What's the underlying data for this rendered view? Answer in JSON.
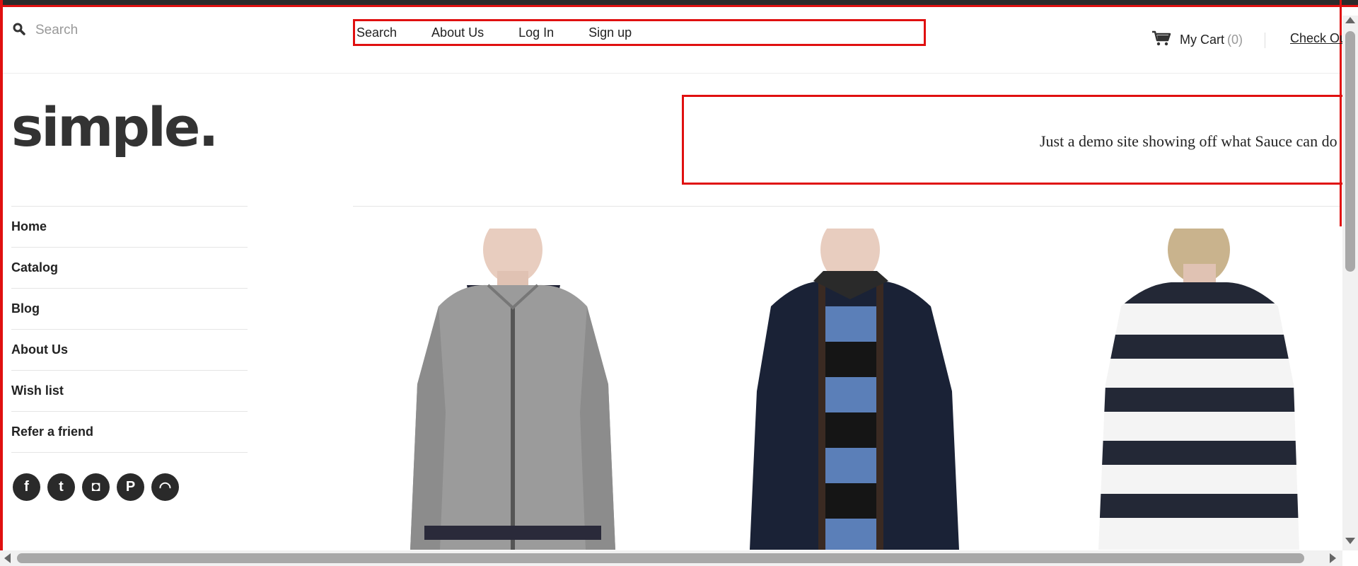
{
  "header": {
    "search_placeholder": "Search",
    "nav": [
      "Search",
      "About Us",
      "Log In",
      "Sign up"
    ],
    "cart_label": "My Cart",
    "cart_count": "(0)",
    "checkout_label": "Check Out"
  },
  "logo": {
    "text": "simple."
  },
  "banner": {
    "text": "Just a demo site showing off what Sauce can do"
  },
  "sidebar": {
    "items": [
      {
        "label": "Home"
      },
      {
        "label": "Catalog"
      },
      {
        "label": "Blog"
      },
      {
        "label": "About Us"
      },
      {
        "label": "Wish list"
      },
      {
        "label": "Refer a friend"
      }
    ],
    "social": [
      {
        "icon": "facebook-icon",
        "glyph": "f"
      },
      {
        "icon": "twitter-icon",
        "glyph": "t"
      },
      {
        "icon": "instagram-icon",
        "glyph": "◘"
      },
      {
        "icon": "pinterest-icon",
        "glyph": "P"
      },
      {
        "icon": "rss-icon",
        "glyph": "◠"
      }
    ]
  },
  "products": [
    {
      "image": "grey-zip-jacket-photo"
    },
    {
      "image": "navy-jacket-striped-sweater-photo"
    },
    {
      "image": "striped-sweater-back-photo"
    }
  ],
  "colors": {
    "accent_outline": "#e01010",
    "text": "#222222",
    "muted": "#999999"
  }
}
